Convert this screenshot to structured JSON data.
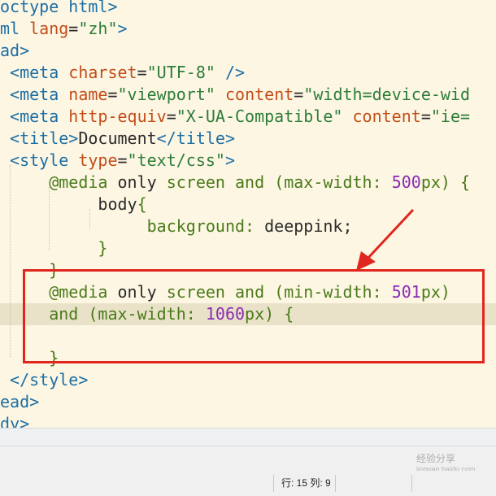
{
  "colors": {
    "tag": "#1d6fa5",
    "attr": "#c24d1a",
    "string": "#2d7d3a",
    "text": "#2a2a2a",
    "keyword": "#4a7a1a",
    "number": "#8a2bb5",
    "annotation": "#e0261e"
  },
  "code_lines": [
    [
      {
        "t": "octype html>",
        "c": "tag"
      }
    ],
    [
      {
        "t": "ml ",
        "c": "tag"
      },
      {
        "t": "lang",
        "c": "attr"
      },
      {
        "t": "=",
        "c": "text"
      },
      {
        "t": "\"zh\"",
        "c": "string"
      },
      {
        "t": ">",
        "c": "tag"
      }
    ],
    [
      {
        "t": "ad>",
        "c": "tag"
      }
    ],
    [
      {
        "t": " <meta ",
        "c": "tag"
      },
      {
        "t": "charset",
        "c": "attr"
      },
      {
        "t": "=",
        "c": "text"
      },
      {
        "t": "\"UTF-8\"",
        "c": "string"
      },
      {
        "t": " />",
        "c": "tag"
      }
    ],
    [
      {
        "t": " <meta ",
        "c": "tag"
      },
      {
        "t": "name",
        "c": "attr"
      },
      {
        "t": "=",
        "c": "text"
      },
      {
        "t": "\"viewport\"",
        "c": "string"
      },
      {
        "t": " ",
        "c": "text"
      },
      {
        "t": "content",
        "c": "attr"
      },
      {
        "t": "=",
        "c": "text"
      },
      {
        "t": "\"width=device-wid",
        "c": "string"
      }
    ],
    [
      {
        "t": " <meta ",
        "c": "tag"
      },
      {
        "t": "http-equiv",
        "c": "attr"
      },
      {
        "t": "=",
        "c": "text"
      },
      {
        "t": "\"X-UA-Compatible\"",
        "c": "string"
      },
      {
        "t": " ",
        "c": "text"
      },
      {
        "t": "content",
        "c": "attr"
      },
      {
        "t": "=",
        "c": "text"
      },
      {
        "t": "\"ie=",
        "c": "string"
      }
    ],
    [
      {
        "t": " <title>",
        "c": "tag"
      },
      {
        "t": "Document",
        "c": "text"
      },
      {
        "t": "</title>",
        "c": "tag"
      }
    ],
    [
      {
        "t": " <style ",
        "c": "tag"
      },
      {
        "t": "type",
        "c": "attr"
      },
      {
        "t": "=",
        "c": "text"
      },
      {
        "t": "\"text/css\"",
        "c": "string"
      },
      {
        "t": ">",
        "c": "tag"
      }
    ],
    [
      {
        "t": "     @media ",
        "c": "keyword"
      },
      {
        "t": "only ",
        "c": "text"
      },
      {
        "t": "screen ",
        "c": "keyword"
      },
      {
        "t": "and ",
        "c": "keyword"
      },
      {
        "t": "(max-width: ",
        "c": "keyword"
      },
      {
        "t": "500",
        "c": "number"
      },
      {
        "t": "px) {",
        "c": "keyword"
      }
    ],
    [
      {
        "t": "          body",
        "c": "text"
      },
      {
        "t": "{",
        "c": "keyword"
      }
    ],
    [
      {
        "t": "               background: ",
        "c": "keyword"
      },
      {
        "t": "deeppink;",
        "c": "text"
      }
    ],
    [
      {
        "t": "          }",
        "c": "keyword"
      }
    ],
    [
      {
        "t": "     }",
        "c": "keyword"
      }
    ],
    [
      {
        "t": "     @media ",
        "c": "keyword"
      },
      {
        "t": "only ",
        "c": "text"
      },
      {
        "t": "screen ",
        "c": "keyword"
      },
      {
        "t": "and ",
        "c": "keyword"
      },
      {
        "t": "(min-width: ",
        "c": "keyword"
      },
      {
        "t": "501",
        "c": "number"
      },
      {
        "t": "px)",
        "c": "keyword"
      }
    ],
    [
      {
        "t": "     and ",
        "c": "keyword"
      },
      {
        "t": "(max-width: ",
        "c": "keyword"
      },
      {
        "t": "1060",
        "c": "number"
      },
      {
        "t": "px) {",
        "c": "keyword"
      }
    ],
    [
      {
        "t": "",
        "c": "text"
      }
    ],
    [
      {
        "t": "     }",
        "c": "keyword"
      }
    ],
    [
      {
        "t": " </style>",
        "c": "tag"
      }
    ],
    [
      {
        "t": "ead>",
        "c": "tag"
      }
    ],
    [
      {
        "t": "dy>",
        "c": "tag"
      }
    ]
  ],
  "current_line_index": 14,
  "status": {
    "position": "行: 15 列: 9"
  },
  "watermark": {
    "text": "经验分享",
    "url": "jingyan.baidu.com"
  }
}
